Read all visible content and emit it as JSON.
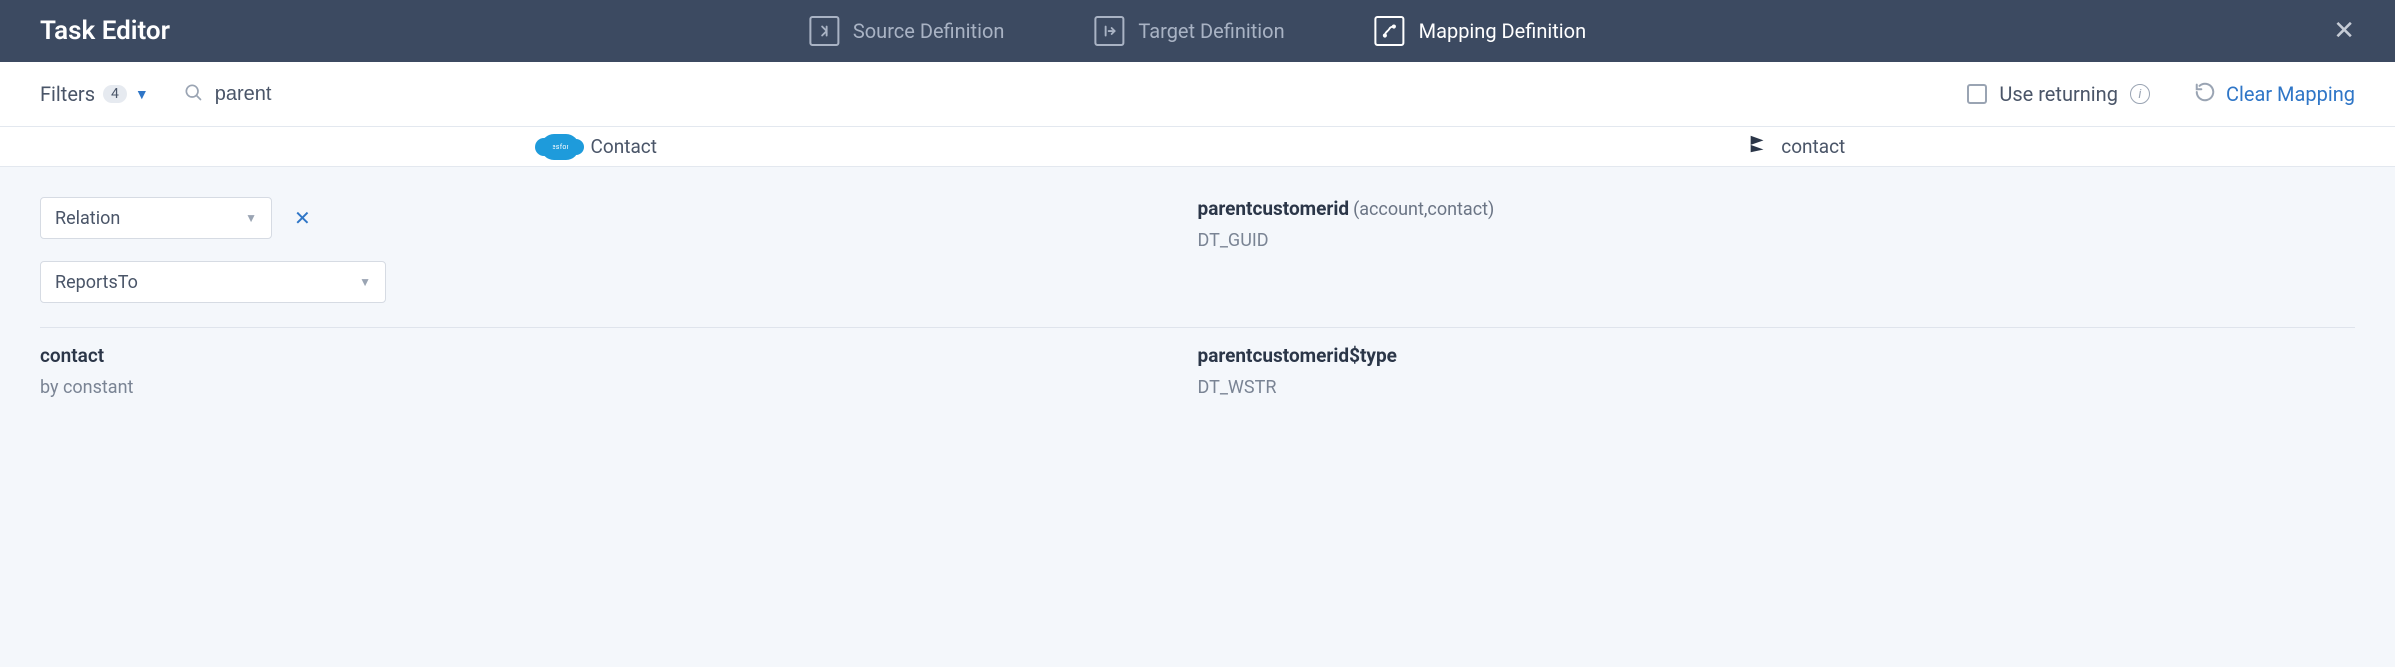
{
  "header": {
    "title": "Task Editor",
    "tabs": [
      {
        "label": "Source Definition",
        "active": false
      },
      {
        "label": "Target Definition",
        "active": false
      },
      {
        "label": "Mapping Definition",
        "active": true
      }
    ]
  },
  "toolbar": {
    "filters_label": "Filters",
    "filters_count": "4",
    "search_value": "parent",
    "search_placeholder": "",
    "use_returning_label": "Use returning",
    "clear_mapping_label": "Clear Mapping"
  },
  "columns": {
    "source_label": "Contact",
    "target_label": "contact"
  },
  "mappings": [
    {
      "left": {
        "mode": "controls",
        "type_select": "Relation",
        "relation_select": "ReportsTo"
      },
      "right": {
        "field": "parentcustomerid",
        "annotation": "(account,contact)",
        "datatype": "DT_GUID"
      }
    },
    {
      "left": {
        "mode": "text",
        "primary": "contact",
        "sub": "by constant"
      },
      "right": {
        "field": "parentcustomerid$type",
        "annotation": "",
        "datatype": "DT_WSTR"
      }
    }
  ]
}
